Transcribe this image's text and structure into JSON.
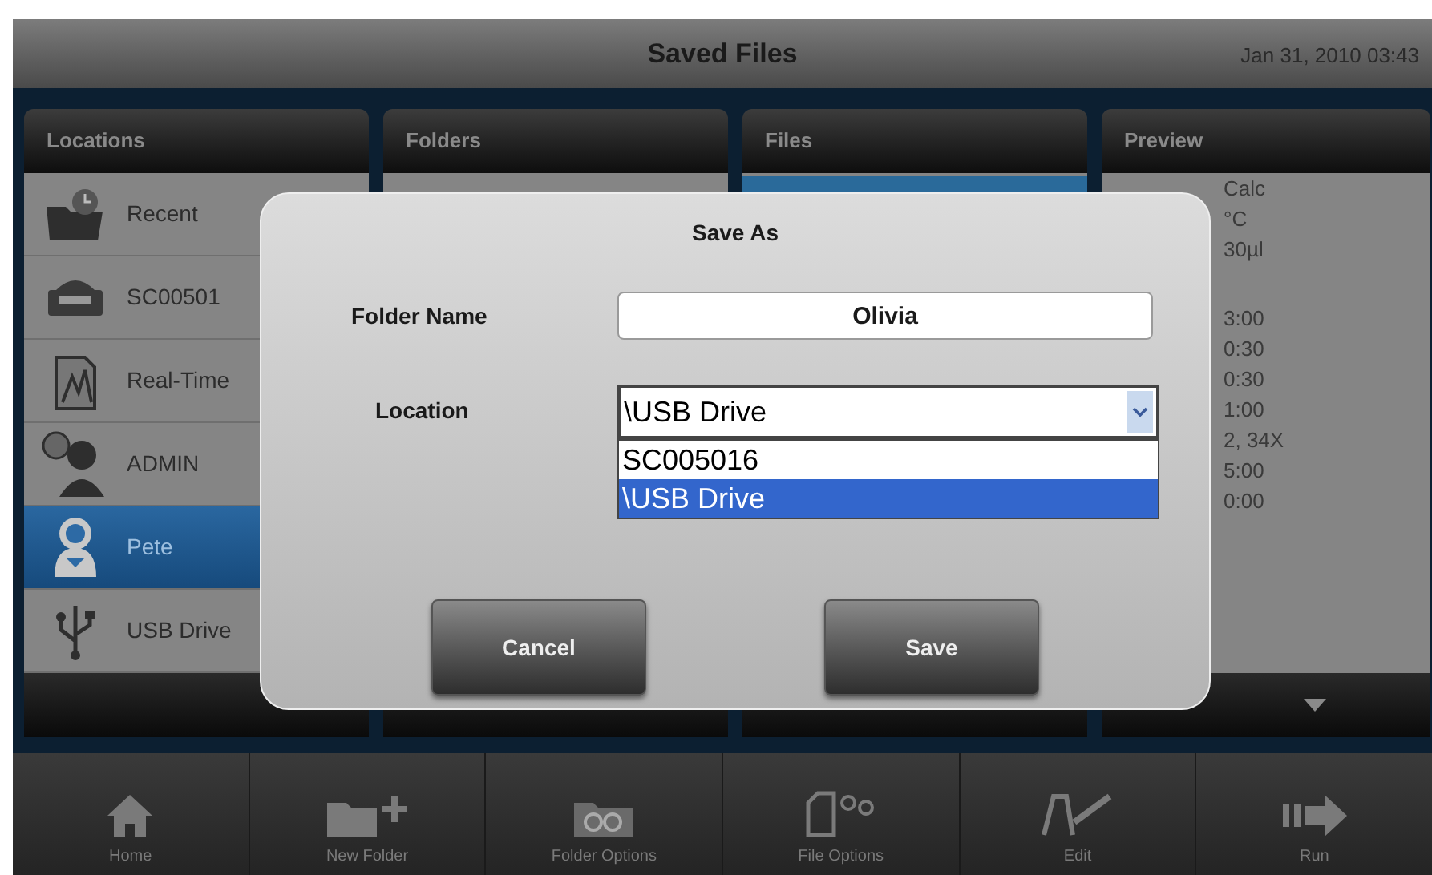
{
  "title_bar": {
    "title": "Saved Files",
    "datetime": "Jan 31, 2010 03:43"
  },
  "columns": [
    {
      "heading": "Locations"
    },
    {
      "heading": "Folders"
    },
    {
      "heading": "Files"
    },
    {
      "heading": "Preview"
    }
  ],
  "locations": [
    {
      "label": "Recent",
      "kind": "recent",
      "selected": false
    },
    {
      "label": "SC00501",
      "kind": "instrument",
      "selected": false
    },
    {
      "label": "Real-Time",
      "kind": "realtime",
      "selected": false
    },
    {
      "label": "ADMIN",
      "kind": "admin",
      "selected": false
    },
    {
      "label": "Pete",
      "kind": "user",
      "selected": true
    },
    {
      "label": "USB Drive",
      "kind": "usb",
      "selected": false
    }
  ],
  "preview_groups": [
    [
      "Calc",
      "°C",
      "30µl"
    ],
    [
      "3:00",
      "0:30",
      "0:30",
      "1:00",
      "2, 34X",
      "5:00",
      "0:00"
    ]
  ],
  "dialog": {
    "title": "Save As",
    "folder_name": {
      "label": "Folder Name",
      "value": "Olivia"
    },
    "location": {
      "label": "Location",
      "value": "\\USB Drive",
      "options": [
        {
          "label": "SC005016",
          "selected": false
        },
        {
          "label": "\\USB Drive",
          "selected": true
        }
      ]
    },
    "buttons": [
      "Cancel",
      "Save"
    ]
  },
  "toolbar": [
    {
      "label": "Home",
      "kind": "home"
    },
    {
      "label": "New Folder",
      "kind": "new_folder"
    },
    {
      "label": "Folder Options",
      "kind": "folder_options"
    },
    {
      "label": "File Options",
      "kind": "file_options"
    },
    {
      "label": "Edit",
      "kind": "edit"
    },
    {
      "label": "Run",
      "kind": "run"
    }
  ]
}
